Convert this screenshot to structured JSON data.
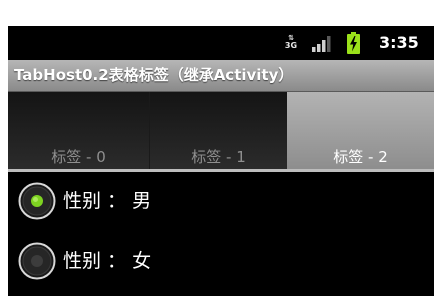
{
  "status_bar": {
    "network": "3G",
    "signal_icon": "signal-bars-icon",
    "battery_icon": "battery-charging-icon",
    "time": "3:35",
    "battery_color": "#9be11a"
  },
  "app": {
    "title": "TabHost0.2表格标签（继承Activity）"
  },
  "tabs": [
    {
      "label": "标签 - 0",
      "selected": false
    },
    {
      "label": "标签 - 1",
      "selected": false
    },
    {
      "label": "标签 - 2",
      "selected": true
    }
  ],
  "content": {
    "radios": [
      {
        "label": "性别 ： 男",
        "checked": true
      },
      {
        "label": "性别 ： 女",
        "checked": false
      }
    ],
    "checked_color": "#7ed321"
  }
}
